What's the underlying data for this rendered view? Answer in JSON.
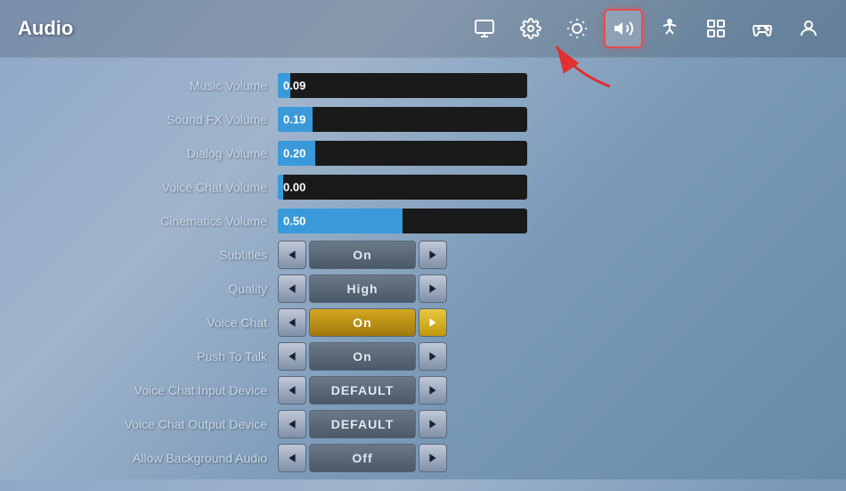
{
  "page": {
    "title": "Audio"
  },
  "nav": {
    "icons": [
      {
        "name": "monitor-icon",
        "symbol": "🖥",
        "active": false,
        "label": "Display"
      },
      {
        "name": "gear-icon",
        "symbol": "⚙",
        "active": false,
        "label": "Settings"
      },
      {
        "name": "brightness-icon",
        "symbol": "☀",
        "active": false,
        "label": "Brightness"
      },
      {
        "name": "audio-icon",
        "symbol": "🔊",
        "active": true,
        "label": "Audio"
      },
      {
        "name": "accessibility-icon",
        "symbol": "♿",
        "active": false,
        "label": "Accessibility"
      },
      {
        "name": "network-icon",
        "symbol": "⊞",
        "active": false,
        "label": "Network"
      },
      {
        "name": "controller-icon",
        "symbol": "🎮",
        "active": false,
        "label": "Controller"
      },
      {
        "name": "account-icon",
        "symbol": "👤",
        "active": false,
        "label": "Account"
      }
    ]
  },
  "settings": {
    "sliders": [
      {
        "label": "Music Volume",
        "value": "0.09",
        "fillPercent": 5
      },
      {
        "label": "Sound FX Volume",
        "value": "0.19",
        "fillPercent": 14
      },
      {
        "label": "Dialog Volume",
        "value": "0.20",
        "fillPercent": 15
      },
      {
        "label": "Voice Chat Volume",
        "value": "0.00",
        "fillPercent": 0
      },
      {
        "label": "Cinematics Volume",
        "value": "0.50",
        "fillPercent": 50
      }
    ],
    "toggles": [
      {
        "label": "Subtitles",
        "value": "On",
        "highlighted": false
      },
      {
        "label": "Quality",
        "value": "High",
        "highlighted": false
      },
      {
        "label": "Voice Chat",
        "value": "On",
        "highlighted": true
      },
      {
        "label": "Push To Talk",
        "value": "On",
        "highlighted": false
      },
      {
        "label": "Voice Chat Input Device",
        "value": "DEFAULT",
        "highlighted": false
      },
      {
        "label": "Voice Chat Output Device",
        "value": "DEFAULT",
        "highlighted": false
      },
      {
        "label": "Allow Background Audio",
        "value": "Off",
        "highlighted": false
      }
    ],
    "arrow_left": "◀",
    "arrow_right": "▶"
  }
}
